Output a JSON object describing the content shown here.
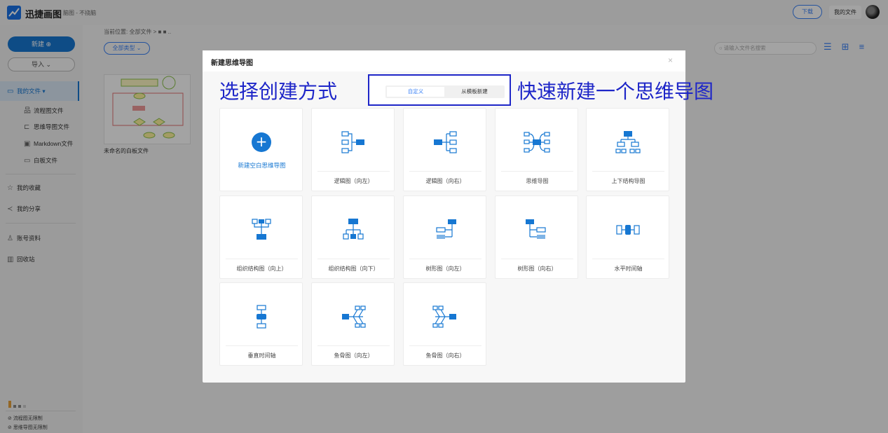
{
  "app": {
    "title": "迅捷画图",
    "subtitle": "脑图 - 不挠脑",
    "download_label": "下载",
    "my_files_label": "我的文件"
  },
  "sidebar": {
    "new_label": "新建 ⊕",
    "import_label": "导入 ⌄",
    "my_files": "我的文件",
    "sub_items": [
      {
        "icon": "flowchart-icon",
        "glyph": "品",
        "label": "流程图文件"
      },
      {
        "icon": "mindmap-icon",
        "glyph": "⊏",
        "label": "思维导图文件"
      },
      {
        "icon": "markdown-icon",
        "glyph": "▣",
        "label": "Markdown文件"
      },
      {
        "icon": "whiteboard-icon",
        "glyph": "▭",
        "label": "白板文件"
      }
    ],
    "favorites": "我的收藏",
    "shares": "我的分享",
    "account": "账号资料",
    "recycle": "回收站",
    "quota_flowchart": "流程图无限制",
    "quota_mindmap": "思维导图无限制"
  },
  "main": {
    "breadcrumb": "当前位置: 全部文件 > ■ ■ ..",
    "type_filter": "全部类型 ⌄",
    "search_placeholder": "请输入文件名搜索",
    "file_name": "未命名的白板文件"
  },
  "modal": {
    "title": "新建思维导图",
    "close_glyph": "×",
    "heading_left": "选择创建方式",
    "heading_right": "快速新建一个思维导图",
    "tab_custom": "自定义",
    "tab_template": "从模板新建",
    "new_blank": "新建空白思维导图",
    "templates": [
      {
        "id": "logic-left",
        "label": "逻辑图（向左）"
      },
      {
        "id": "logic-right",
        "label": "逻辑图（向右）"
      },
      {
        "id": "mindmap",
        "label": "思维导图"
      },
      {
        "id": "topdown",
        "label": "上下结构导图"
      },
      {
        "id": "org-up",
        "label": "组织结构图（向上）"
      },
      {
        "id": "org-down",
        "label": "组织结构图（向下）"
      },
      {
        "id": "tree-left",
        "label": "树形图（向左）"
      },
      {
        "id": "tree-right",
        "label": "树形图（向右）"
      },
      {
        "id": "h-timeline",
        "label": "水平时间轴"
      },
      {
        "id": "v-timeline",
        "label": "垂直时间轴"
      },
      {
        "id": "fish-left",
        "label": "鱼骨图（向左）"
      },
      {
        "id": "fish-right",
        "label": "鱼骨图（向右）"
      }
    ]
  },
  "colors": {
    "accent": "#1677d2",
    "annotation": "#1e26c8"
  }
}
